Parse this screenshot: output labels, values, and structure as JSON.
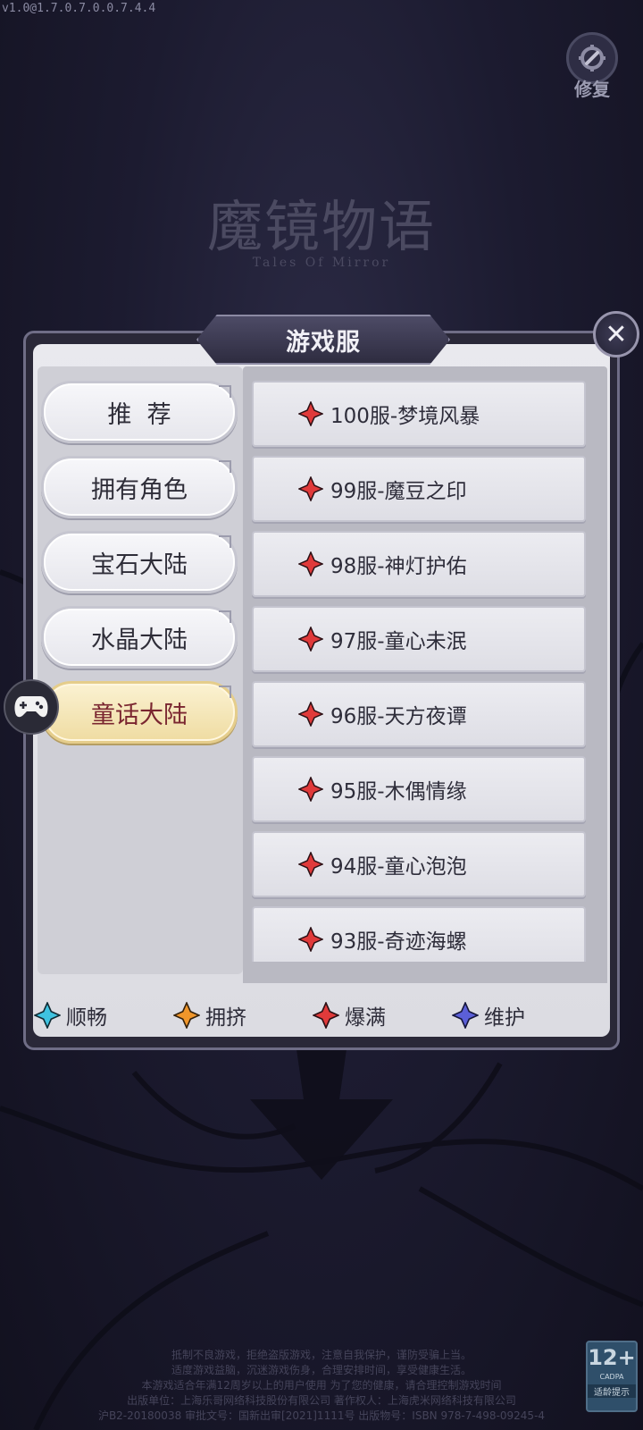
{
  "version": "v1.0@1.7.0.7.0.0.7.4.4",
  "repair": {
    "label": "修复"
  },
  "logo": {
    "title": "魔镜物语",
    "subtitle": "Tales Of Mirror"
  },
  "dialog": {
    "title": "游戏服",
    "close_label": "✕",
    "categories": [
      {
        "label": "推  荐",
        "active": false
      },
      {
        "label": "拥有角色",
        "active": false
      },
      {
        "label": "宝石大陆",
        "active": false
      },
      {
        "label": "水晶大陆",
        "active": false
      },
      {
        "label": "童话大陆",
        "active": true
      }
    ],
    "servers": [
      {
        "name": "100服-梦境风暴",
        "status": "爆满"
      },
      {
        "name": "99服-魔豆之印",
        "status": "爆满"
      },
      {
        "name": "98服-神灯护佑",
        "status": "爆满"
      },
      {
        "name": "97服-童心未泯",
        "status": "爆满"
      },
      {
        "name": "96服-天方夜谭",
        "status": "爆满"
      },
      {
        "name": "95服-木偶情缘",
        "status": "爆满"
      },
      {
        "name": "94服-童心泡泡",
        "status": "爆满"
      },
      {
        "name": "93服-奇迹海螺",
        "status": "爆满"
      }
    ],
    "legend": [
      {
        "label": "顺畅",
        "color": "#3fc3e0"
      },
      {
        "label": "拥挤",
        "color": "#f0962a"
      },
      {
        "label": "爆满",
        "color": "#e03a3a"
      },
      {
        "label": "维护",
        "color": "#5b5fd8"
      }
    ]
  },
  "disclaimer": {
    "lines": [
      "抵制不良游戏，拒绝盗版游戏，注意自我保护，谨防受骗上当。",
      "适度游戏益脑，沉迷游戏伤身，合理安排时间，享受健康生活。",
      "本游戏适合年满12周岁以上的用户使用 为了您的健康，请合理控制游戏时间",
      "出版单位：上海乐哥网络科技股份有限公司 著作权人：上海虎米网络科技有限公司",
      "沪B2-20180038 审批文号：国新出审[2021]1111号 出版物号：ISBN 978-7-498-09245-4"
    ]
  },
  "age_rating": {
    "number": "12+",
    "org": "CADPA",
    "tip": "适龄提示"
  },
  "colors": {
    "full": "#e03a3a",
    "panel_bg": "#e4e4ea",
    "active_tab": "#f3e3b0"
  }
}
